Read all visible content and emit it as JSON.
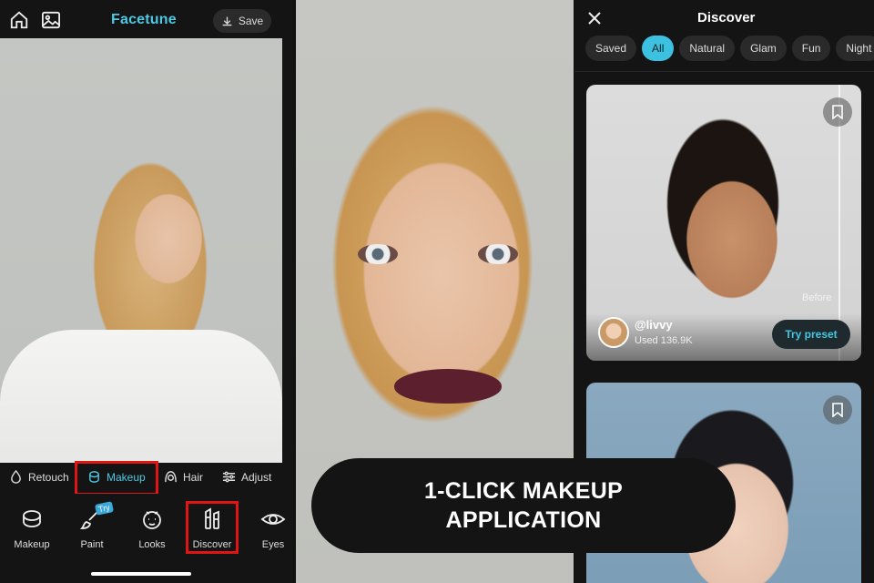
{
  "left_app": {
    "brand": "Facetune",
    "save_label": "Save",
    "tabs": [
      {
        "label": "Retouch",
        "icon": "drop-icon"
      },
      {
        "label": "Makeup",
        "icon": "makeup-icon",
        "active": true
      },
      {
        "label": "Hair",
        "icon": "hair-icon"
      },
      {
        "label": "Adjust",
        "icon": "sliders-icon"
      }
    ],
    "tools": [
      {
        "label": "Makeup",
        "icon": "compact-icon"
      },
      {
        "label": "Paint",
        "icon": "brush-icon",
        "badge": "Try"
      },
      {
        "label": "Looks",
        "icon": "face-icon"
      },
      {
        "label": "Discover",
        "icon": "lipstick-icon"
      },
      {
        "label": "Eyes",
        "icon": "eye-icon"
      }
    ]
  },
  "overlay": {
    "line1": "1-CLICK MAKEUP",
    "line2": "APPLICATION"
  },
  "discover": {
    "title": "Discover",
    "chips": [
      {
        "label": "Saved"
      },
      {
        "label": "All",
        "active": true
      },
      {
        "label": "Natural"
      },
      {
        "label": "Glam"
      },
      {
        "label": "Fun"
      },
      {
        "label": "Night"
      }
    ],
    "card1": {
      "before_label": "Before",
      "handle": "@livvy",
      "used": "Used 136.9K",
      "try_label": "Try preset"
    }
  },
  "colors": {
    "accent": "#4ec9e3",
    "highlight": "#e01515",
    "lipstick": "#5b1f2e"
  }
}
